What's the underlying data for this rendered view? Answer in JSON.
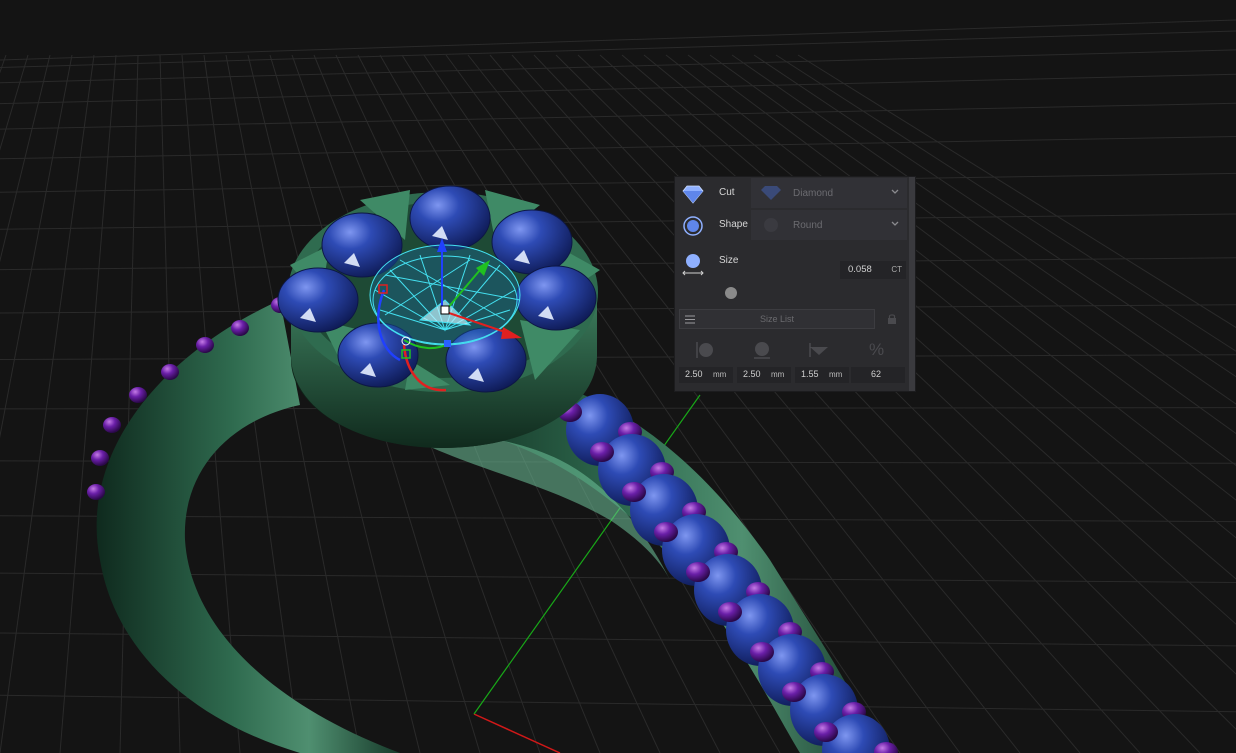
{
  "panel": {
    "cut": {
      "label": "Cut",
      "value": "Diamond"
    },
    "shape": {
      "label": "Shape",
      "value": "Round"
    },
    "size": {
      "label": "Size",
      "value": "0.058",
      "unit": "CT"
    },
    "size_list": {
      "label": "Size List"
    },
    "dimensions": [
      {
        "value": "2.50",
        "unit": "mm",
        "icon": "width-icon"
      },
      {
        "value": "2.50",
        "unit": "mm",
        "icon": "length-icon"
      },
      {
        "value": "1.55",
        "unit": "mm",
        "icon": "depth-icon"
      },
      {
        "value": "62",
        "unit": "",
        "icon": "percent-icon",
        "glyph": "%"
      }
    ]
  },
  "colors": {
    "background": "#141414",
    "grid": "#2c2c2c",
    "metal": "#2f6b4f",
    "stone": "#2a45a6",
    "prong": "#6a1fa8",
    "wireframe": "#44e0f0",
    "axis_x": "#e02020",
    "axis_y": "#20c020",
    "axis_z": "#2040ff"
  }
}
